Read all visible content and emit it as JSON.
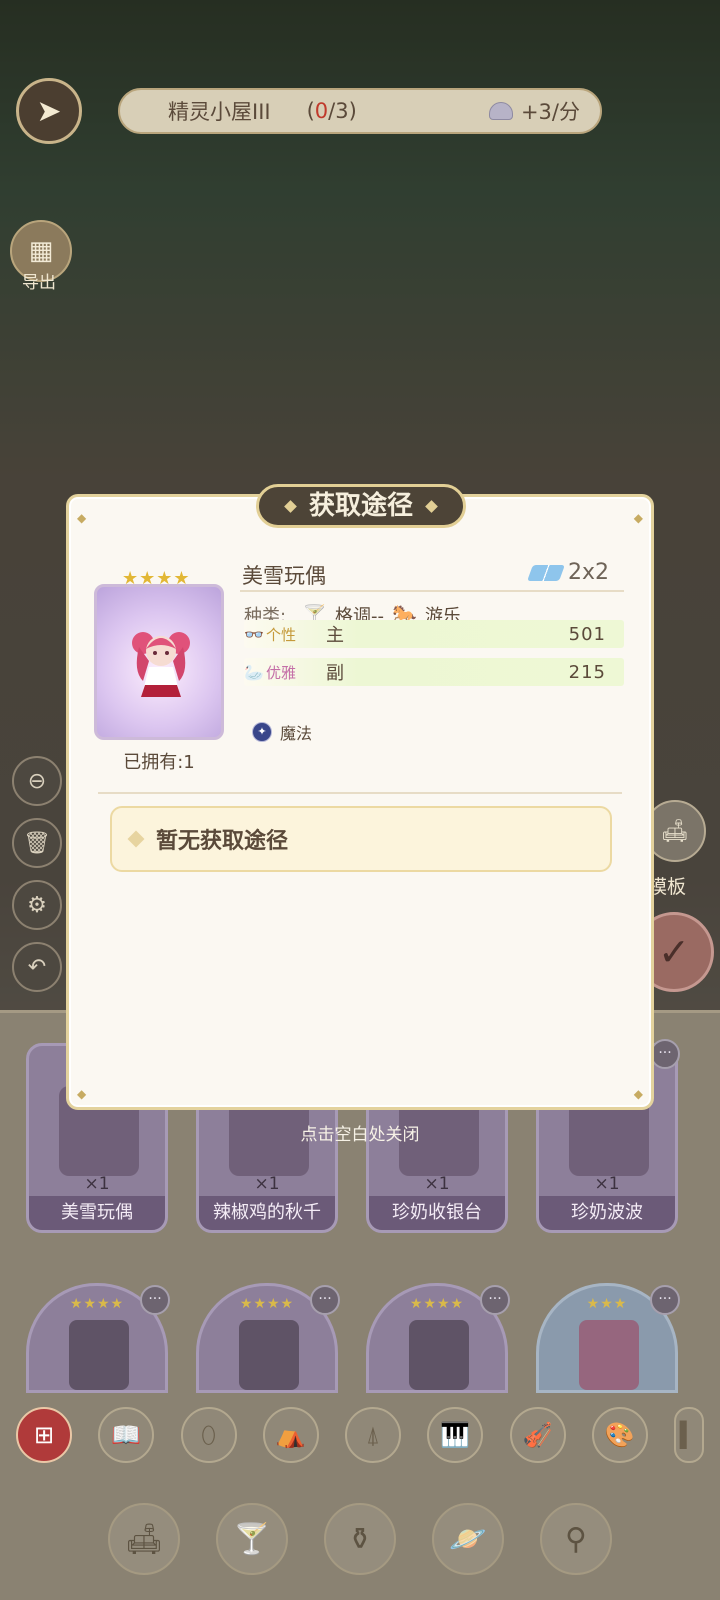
{
  "header": {
    "title": "精灵小屋III",
    "count_open": "(",
    "count_current": "0",
    "count_rest": "/3)",
    "rate": "+3/分"
  },
  "sidebar": {
    "export_label": "导出",
    "template_label": "模板"
  },
  "popup": {
    "banner_title": "获取途径",
    "item": {
      "name": "美雪玩偶",
      "size": "2x2",
      "stars": 4,
      "owned": "已拥有:1",
      "type_label": "种类:",
      "type_1": "格调--",
      "type_2": "游乐",
      "stats": [
        {
          "label": "个性",
          "role": "主",
          "value": "501"
        },
        {
          "label": "优雅",
          "role": "副",
          "value": "215"
        }
      ],
      "tag": "魔法"
    },
    "route_text": "暂无获取途径",
    "close_hint": "点击空白处关闭"
  },
  "inventory": {
    "row1": [
      {
        "qty": "×1",
        "name": "美雪玩偶"
      },
      {
        "qty": "×1",
        "name": "辣椒鸡的秋千"
      },
      {
        "qty": "×1",
        "name": "珍奶收银台"
      },
      {
        "qty": "×1",
        "name": "珍奶波波"
      }
    ],
    "row2_stars": [
      "★★★★",
      "★★★★",
      "★★★★",
      "★★★"
    ],
    "more_label": "···"
  },
  "categories": [
    "grid-icon",
    "book-icon",
    "mirror-icon",
    "tent-icon",
    "lamp-icon",
    "piano-icon",
    "violin-icon",
    "palette-icon",
    "more-icon"
  ],
  "nav": [
    "furniture-icon",
    "cocktail-icon",
    "vase-icon",
    "planet-icon",
    "search-icon"
  ],
  "colors": {
    "banner_bg": "#4d4437",
    "accent_gold": "#e2cf95",
    "count_red": "#c0392b",
    "stat_bar": "#eef8d5"
  }
}
